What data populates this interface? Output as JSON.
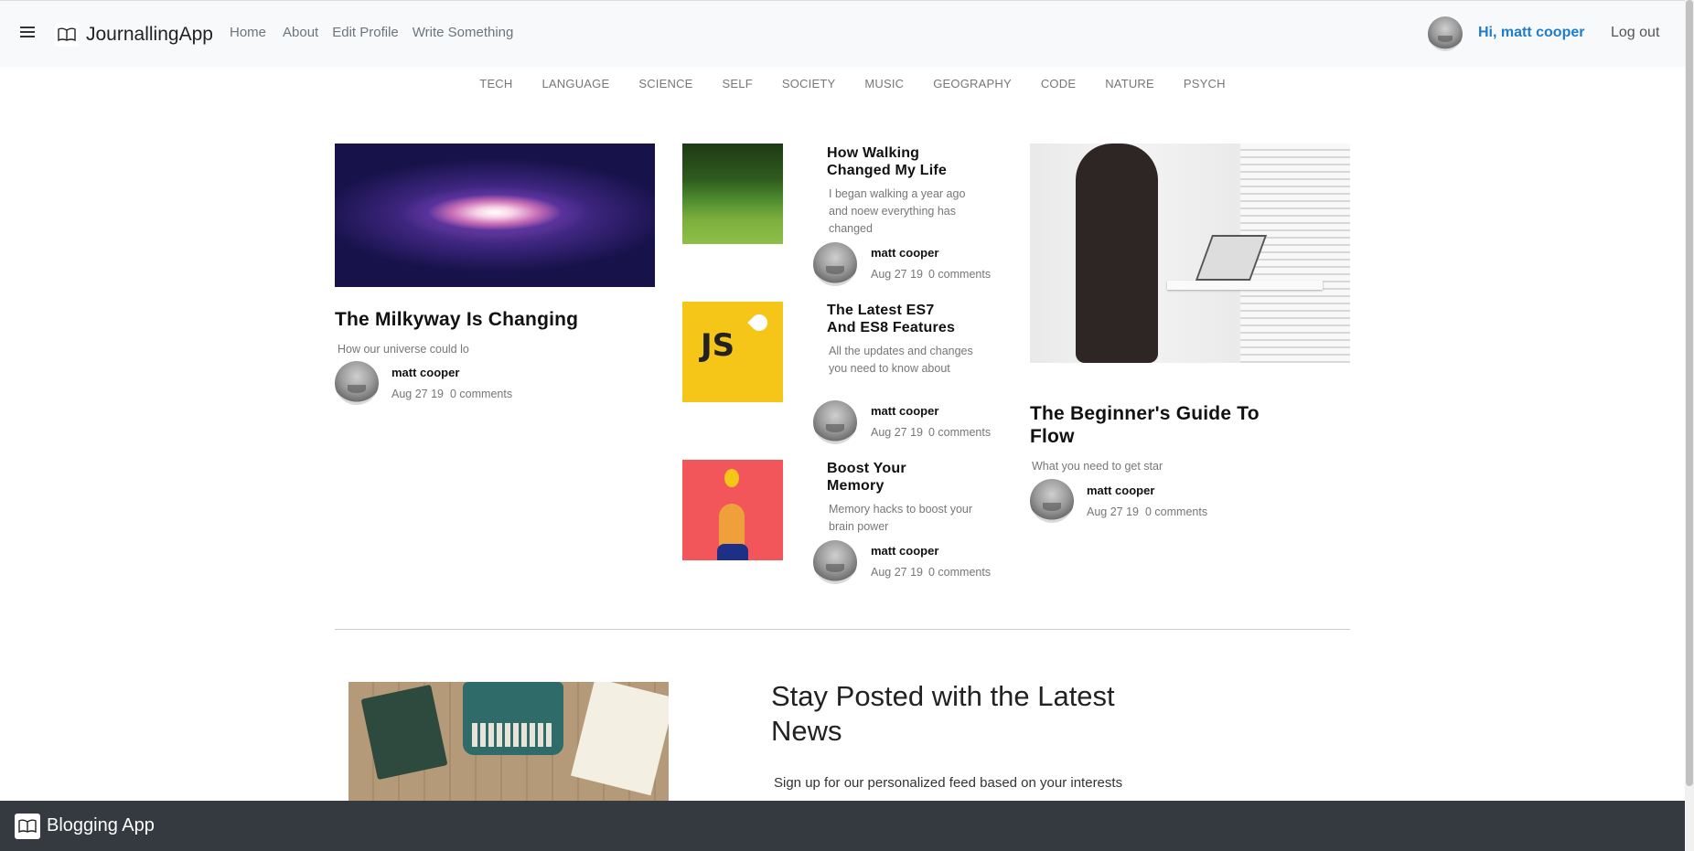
{
  "navbar": {
    "brand": "JournallingApp",
    "links": [
      "Home",
      "About",
      "Edit Profile",
      "Write Something"
    ],
    "greeting": "Hi, matt cooper",
    "logout": "Log out"
  },
  "categories": [
    "TECH",
    "LANGUAGE",
    "SCIENCE",
    "SELF",
    "SOCIETY",
    "MUSIC",
    "GEOGRAPHY",
    "CODE",
    "NATURE",
    "PSYCH"
  ],
  "articles": {
    "milkyway": {
      "title": "The Milkyway Is Changing",
      "description": "How our universe could lo",
      "author": "matt cooper",
      "date": "Aug 27 19",
      "comments": "0 comments"
    },
    "walking": {
      "title": "How Walking Changed My Life",
      "description": "I began walking a year ago and noew everything has changed",
      "author": "matt cooper",
      "date": "Aug 27 19",
      "comments": "0 comments"
    },
    "es7": {
      "title": "The Latest ES7 And ES8 Features",
      "description": "All the updates and changes you need to know about",
      "author": "matt cooper",
      "date": "Aug 27 19",
      "comments": "0 comments",
      "image_text": "JS"
    },
    "memory": {
      "title": "Boost Your Memory",
      "description": "Memory hacks to boost your brain power",
      "author": "matt cooper",
      "date": "Aug 27 19",
      "comments": "0 comments"
    },
    "flow": {
      "title": "The Beginner's Guide To Flow",
      "description": "What you need to get star",
      "author": "matt cooper",
      "date": "Aug 27 19",
      "comments": "0 comments"
    }
  },
  "newsletter": {
    "title": "Stay Posted with the Latest News",
    "subtitle": "Sign up for our personalized feed based on your interests"
  },
  "footer": {
    "brand": "Blogging App"
  }
}
